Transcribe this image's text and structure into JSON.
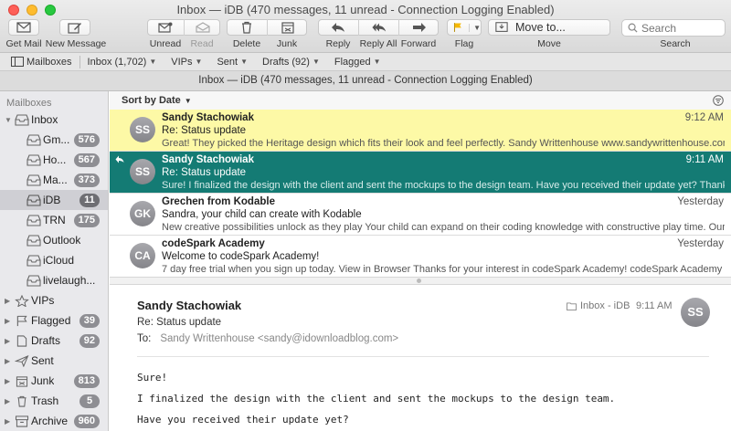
{
  "window": {
    "title": "Inbox — iDB (470 messages, 11 unread - Connection Logging Enabled)"
  },
  "toolbar": {
    "get_mail": "Get Mail",
    "new_message": "New Message",
    "unread": "Unread",
    "read": "Read",
    "delete": "Delete",
    "junk": "Junk",
    "reply": "Reply",
    "reply_all": "Reply All",
    "forward": "Forward",
    "flag": "Flag",
    "move_to": "Move to...",
    "move": "Move",
    "search_placeholder": "Search",
    "search": "Search"
  },
  "favorites": {
    "mailboxes": "Mailboxes",
    "inbox": "Inbox (1,702)",
    "vips": "VIPs",
    "sent": "Sent",
    "drafts": "Drafts (92)",
    "flagged": "Flagged"
  },
  "view_title": "Inbox — iDB (470 messages, 11 unread - Connection Logging Enabled)",
  "sidebar": {
    "header": "Mailboxes",
    "inbox": {
      "label": "Inbox"
    },
    "accounts": [
      {
        "label": "Gm...",
        "count": "576"
      },
      {
        "label": "Ho...",
        "count": "567"
      },
      {
        "label": "Ma...",
        "count": "373"
      },
      {
        "label": "iDB",
        "count": "11"
      },
      {
        "label": "TRN",
        "count": "175"
      },
      {
        "label": "Outlook",
        "count": ""
      },
      {
        "label": "iCloud",
        "count": ""
      },
      {
        "label": "livelaugh...",
        "count": ""
      }
    ],
    "vips": {
      "label": "VIPs"
    },
    "flagged": {
      "label": "Flagged",
      "count": "39"
    },
    "drafts": {
      "label": "Drafts",
      "count": "92"
    },
    "sent": {
      "label": "Sent"
    },
    "junk": {
      "label": "Junk",
      "count": "813"
    },
    "trash": {
      "label": "Trash",
      "count": "5"
    },
    "archive": {
      "label": "Archive",
      "count": "960"
    }
  },
  "list": {
    "sort_label": "Sort by Date",
    "messages": [
      {
        "initials": "SS",
        "from": "Sandy Stachowiak",
        "date": "9:12 AM",
        "subject": "Re: Status update",
        "preview": "Great! They picked the Heritage design which fits their look and feel perfectly. Sandy Writtenhouse www.sandywrittenhouse.com @san..."
      },
      {
        "initials": "SS",
        "from": "Sandy Stachowiak",
        "date": "9:11 AM",
        "subject": "Re: Status update",
        "preview": "Sure! I finalized the design with the client and sent the mockups to the design team. Have you received their update yet? Thanks, San..."
      },
      {
        "initials": "GK",
        "from": "Grechen from Kodable",
        "date": "Yesterday",
        "subject": "Sandra, your child can create with Kodable",
        "preview": "New creative possibilities unlock as they play Your child can expand on their coding knowledge with constructive play time.  Our Astero..."
      },
      {
        "initials": "CA",
        "from": "codeSpark Academy",
        "date": "Yesterday",
        "subject": "Welcome to codeSpark Academy!",
        "preview": "7 day free trial when you sign up today.   View in Browser    Thanks for your interest in codeSpark Academy! codeSpark Academy was d..."
      }
    ]
  },
  "reader": {
    "from": "Sandy Stachowiak",
    "subject": "Re: Status update",
    "to_label": "To:",
    "to": "Sandy Writtenhouse <sandy@idownloadblog.com>",
    "mailbox": "Inbox - iDB",
    "time": "9:11 AM",
    "initials": "SS",
    "body": [
      "Sure!",
      "I finalized the design with the client and sent the mockups to the design team.",
      "Have you received their update yet?"
    ]
  },
  "colors": {
    "selected_row": "#147b74",
    "highlight_row": "#fdf9a6",
    "flag": "#f5b800",
    "close": "#fe5f57",
    "minimize": "#febc2e",
    "zoom": "#28c840"
  }
}
